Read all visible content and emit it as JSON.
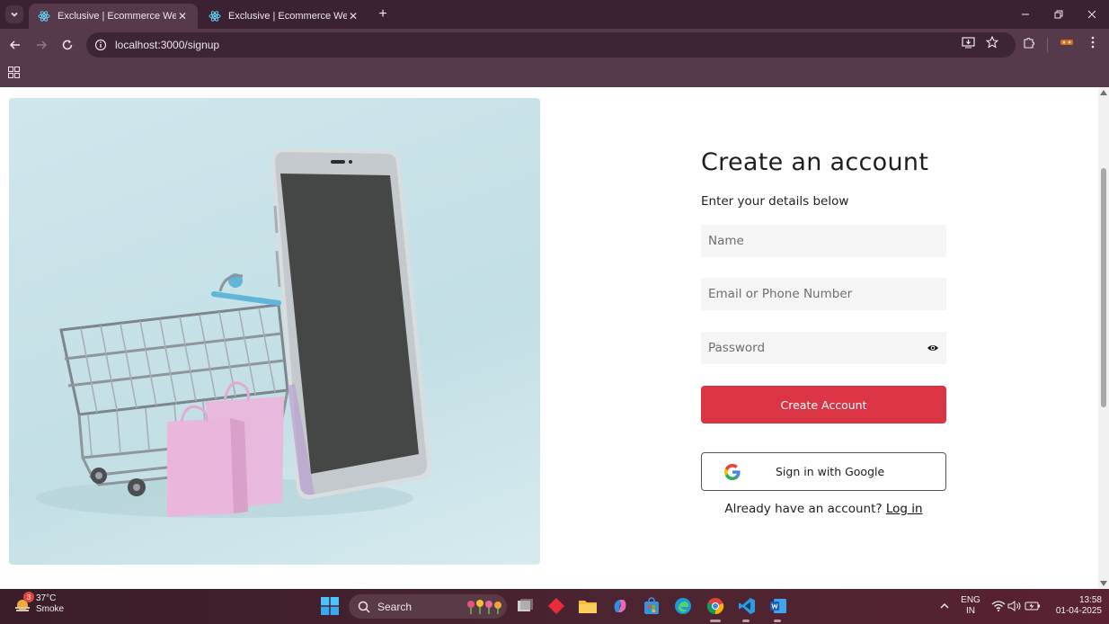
{
  "browser": {
    "tabs": [
      {
        "title": "Exclusive | Ecommerce Website",
        "active": true
      },
      {
        "title": "Exclusive | Ecommerce Website",
        "active": false
      }
    ],
    "url": "localhost:3000/signup"
  },
  "signup": {
    "title": "Create an account",
    "subtitle": "Enter your details below",
    "name_placeholder": "Name",
    "email_placeholder": "Email or Phone Number",
    "password_placeholder": "Password",
    "create_button": "Create Account",
    "google_button": "Sign in with Google",
    "login_prompt": "Already have an account?",
    "login_link": "Log in"
  },
  "colors": {
    "accent": "#db3444",
    "browser_frame": "#563a4c"
  },
  "taskbar": {
    "weather_badge": "3",
    "temperature": "37°C",
    "condition": "Smoke",
    "search_label": "Search",
    "language": "ENG",
    "region": "IN",
    "time": "13:58",
    "date": "01-04-2025"
  }
}
